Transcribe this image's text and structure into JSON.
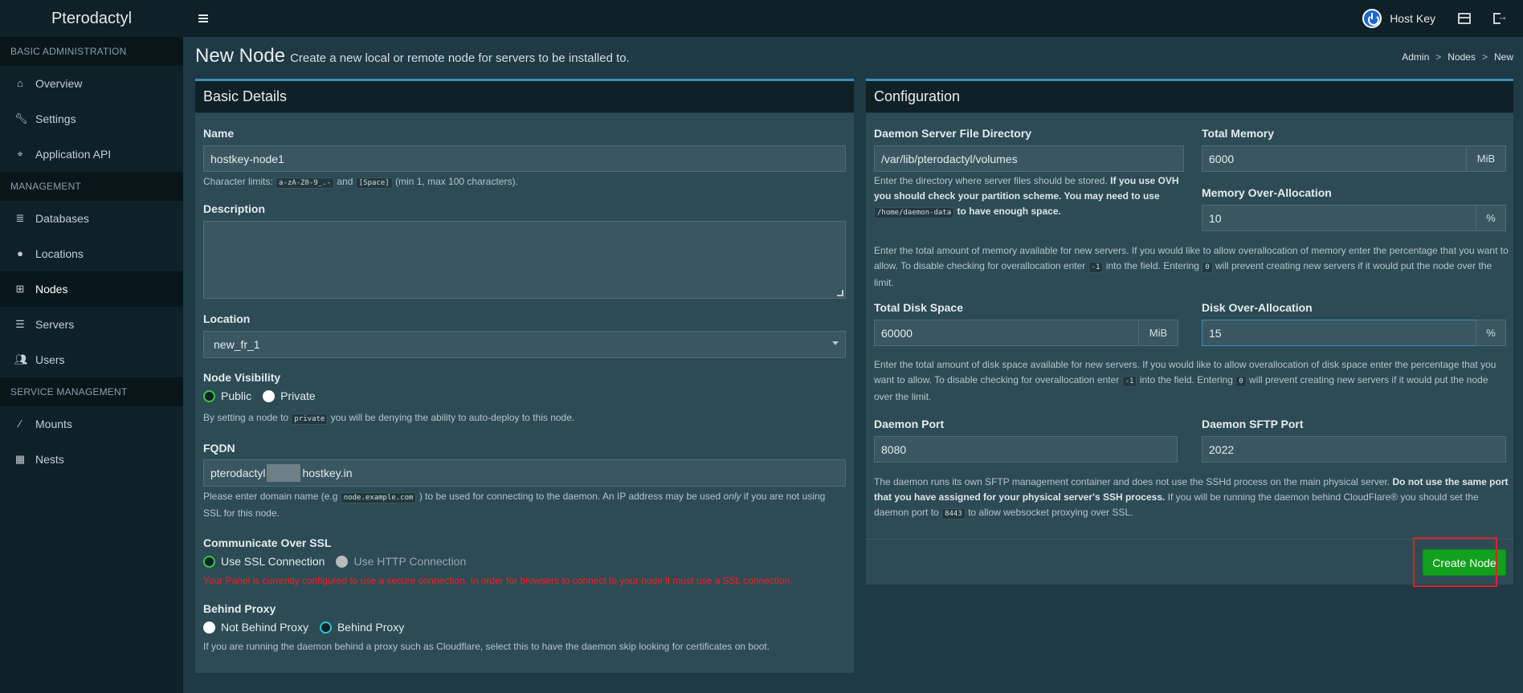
{
  "app": {
    "name": "Pterodactyl"
  },
  "topbar": {
    "user_name": "Host Key"
  },
  "sidebar": {
    "sections": [
      {
        "header": "BASIC ADMINISTRATION",
        "items": [
          {
            "label": "Overview",
            "icon": "home-icon"
          },
          {
            "label": "Settings",
            "icon": "wrench-icon"
          },
          {
            "label": "Application API",
            "icon": "gamepad-icon"
          }
        ]
      },
      {
        "header": "MANAGEMENT",
        "items": [
          {
            "label": "Databases",
            "icon": "database-icon"
          },
          {
            "label": "Locations",
            "icon": "globe-icon"
          },
          {
            "label": "Nodes",
            "icon": "sitemap-icon",
            "active": true
          },
          {
            "label": "Servers",
            "icon": "server-icon"
          },
          {
            "label": "Users",
            "icon": "users-icon"
          }
        ]
      },
      {
        "header": "SERVICE MANAGEMENT",
        "items": [
          {
            "label": "Mounts",
            "icon": "magic-icon"
          },
          {
            "label": "Nests",
            "icon": "th-large-icon"
          }
        ]
      }
    ]
  },
  "page": {
    "title": "New Node",
    "subtitle": "Create a new local or remote node for servers to be installed to.",
    "breadcrumb": [
      "Admin",
      "Nodes",
      "New"
    ]
  },
  "basic": {
    "heading": "Basic Details",
    "name_label": "Name",
    "name_value": "hostkey-node1",
    "name_help_prefix": "Character limits:",
    "name_help_code1": "a-zA-Z0-9_.-",
    "name_help_and": "and",
    "name_help_code2": "[Space]",
    "name_help_suffix": "(min 1, max 100 characters).",
    "description_label": "Description",
    "description_value": "",
    "location_label": "Location",
    "location_value": "new_fr_1",
    "visibility_label": "Node Visibility",
    "visibility_public": "Public",
    "visibility_private": "Private",
    "visibility_help_prefix": "By setting a node to",
    "visibility_help_code": "private",
    "visibility_help_suffix": "you will be denying the ability to auto-deploy to this node.",
    "fqdn_label": "FQDN",
    "fqdn_part1": "pterodactyl",
    "fqdn_part2": "hostkey.in",
    "fqdn_help_1": "Please enter domain name (e.g",
    "fqdn_help_code": "node.example.com",
    "fqdn_help_2": ") to be used for connecting to the daemon. An IP address may be used",
    "fqdn_help_only": "only",
    "fqdn_help_3": "if you are not using",
    "fqdn_help_4": "SSL for this node.",
    "ssl_label": "Communicate Over SSL",
    "ssl_option1": "Use SSL Connection",
    "ssl_option2": "Use HTTP Connection",
    "ssl_warning": "Your Panel is currently configured to use a secure connection. In order for browsers to connect to your node it must use a SSL connection.",
    "proxy_label": "Behind Proxy",
    "proxy_option1": "Not Behind Proxy",
    "proxy_option2": "Behind Proxy",
    "proxy_help": "If you are running the daemon behind a proxy such as Cloudflare, select this to have the daemon skip looking for certificates on boot."
  },
  "config": {
    "heading": "Configuration",
    "dir_label": "Daemon Server File Directory",
    "dir_value": "/var/lib/pterodactyl/volumes",
    "dir_help_1": "Enter the directory where server files should be stored.",
    "dir_help_bold1": "If you use OVH",
    "dir_help_bold2": "you should check your partition scheme. You may need to use",
    "dir_help_code": "/home/daemon-data",
    "dir_help_bold3": "to have enough space.",
    "mem_label": "Total Memory",
    "mem_value": "6000",
    "mem_unit": "MiB",
    "mem_over_label": "Memory Over-Allocation",
    "mem_over_value": "10",
    "mem_over_unit": "%",
    "mem_help_1": "Enter the total amount of memory available for new servers. If you would like to allow overallocation of memory enter the percentage that you want to",
    "mem_help_2": "allow. To disable checking for overallocation enter",
    "mem_help_code1": "-1",
    "mem_help_3": "into the field. Entering",
    "mem_help_code2": "0",
    "mem_help_4": "will prevent creating new servers if it would put the node over the",
    "mem_help_5": "limit.",
    "disk_label": "Total Disk Space",
    "disk_value": "60000",
    "disk_unit": "MiB",
    "disk_over_label": "Disk Over-Allocation",
    "disk_over_value": "15",
    "disk_over_unit": "%",
    "disk_help_1": "Enter the total amount of disk space available for new servers. If you would like to allow overallocation of disk space enter the percentage that you",
    "disk_help_2": "want to allow. To disable checking for overallocation enter",
    "disk_help_code1": "-1",
    "disk_help_3": "into the field. Entering",
    "disk_help_code2": "0",
    "disk_help_4": "will prevent creating new servers if it would put the node",
    "disk_help_5": "over the limit.",
    "port_label": "Daemon Port",
    "port_value": "8080",
    "sftp_label": "Daemon SFTP Port",
    "sftp_value": "2022",
    "port_help_1": "The daemon runs its own SFTP management container and does not use the SSHd process on the main physical server.",
    "port_help_bold1": "Do not use the same port",
    "port_help_bold2": "that you have assigned for your physical server's SSH process.",
    "port_help_2": "If you will be running the daemon behind CloudFlare® you should set the",
    "port_help_3": "daemon port to",
    "port_help_code": "8443",
    "port_help_4": "to allow websocket proxying over SSL.",
    "create_button": "Create Node"
  },
  "colors": {
    "accent": "#3c8dbc",
    "create": "#12a11f",
    "highlight": "#e0202a",
    "warning": "#ff1a1a"
  }
}
